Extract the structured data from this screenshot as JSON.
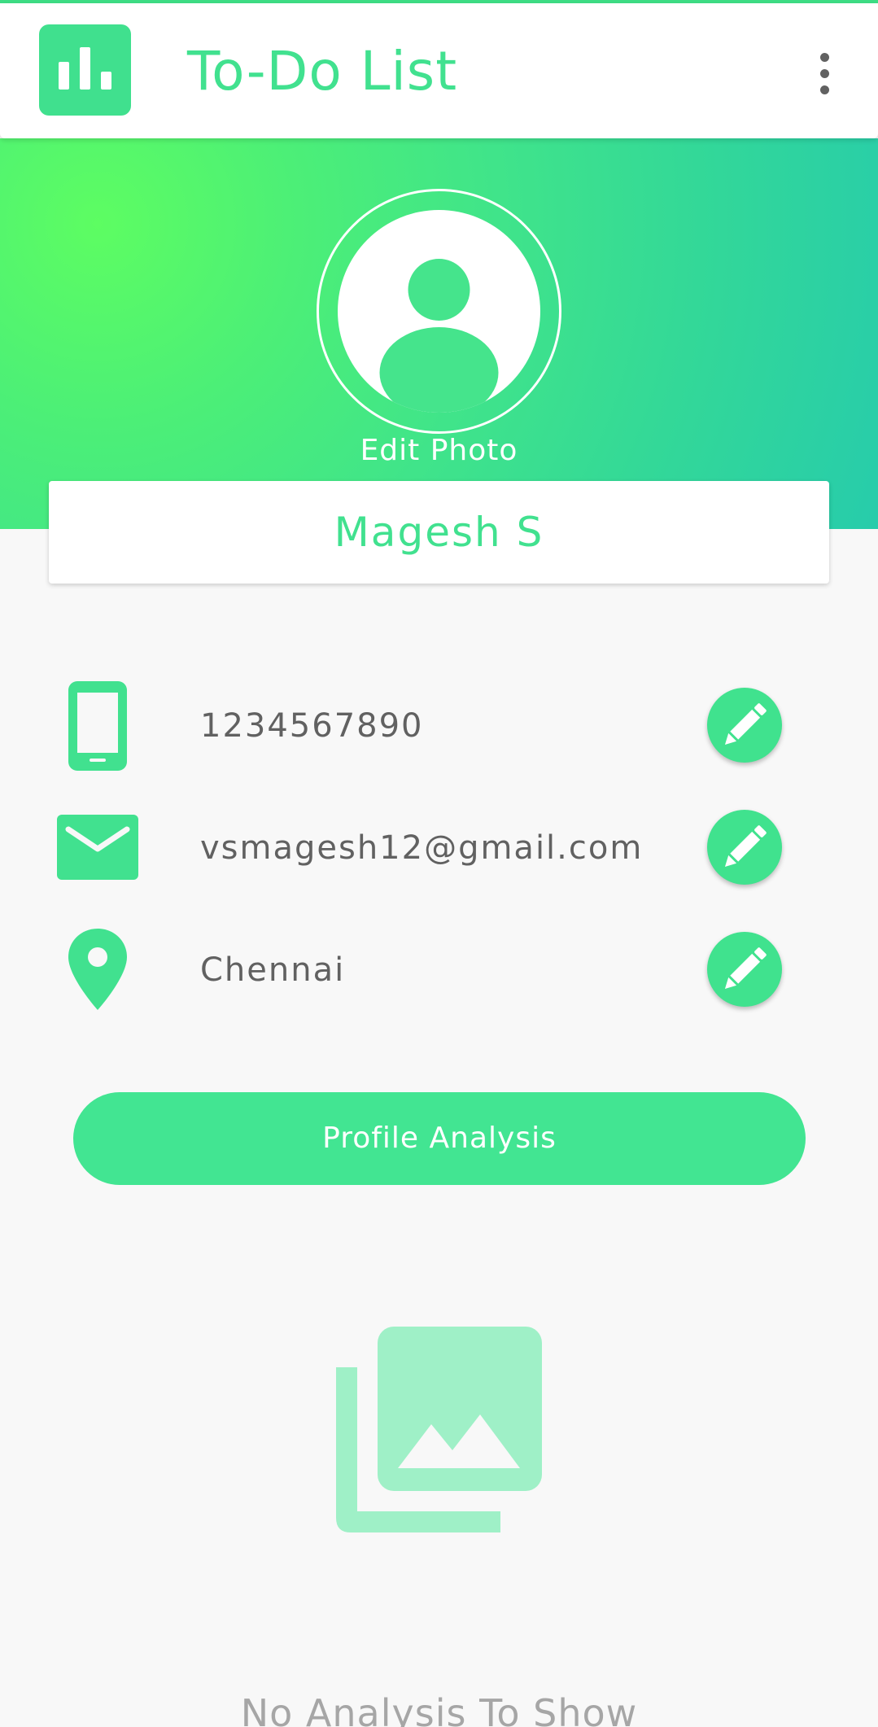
{
  "app_bar": {
    "title": "To-Do List",
    "app_icon": "bar-chart-icon",
    "menu_icon": "more-vert-icon"
  },
  "profile": {
    "edit_photo_label": "Edit Photo",
    "name": "Magesh S",
    "avatar_icon": "account-circle-icon"
  },
  "contact": {
    "phone": "1234567890",
    "email": "vsmagesh12@gmail.com",
    "location": "Chennai",
    "icons": [
      "phone-icon",
      "email-icon",
      "location-pin-icon",
      "pencil-icon"
    ]
  },
  "analysis_button_label": "Profile Analysis",
  "empty_state": {
    "icon": "photo-library-icon",
    "message": "No Analysis To Show"
  },
  "colors": {
    "accent": "#41e18f",
    "gradient_start": "#5dfd62",
    "gradient_end": "#27ccab",
    "text_gray": "#616161",
    "placeholder_icon": "#9ff0c7"
  }
}
